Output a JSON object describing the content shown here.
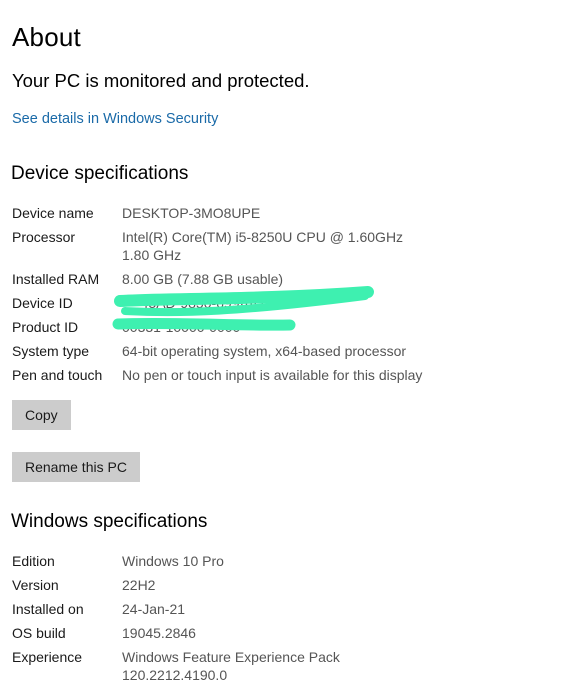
{
  "page": {
    "title": "About",
    "protection_status": "Your PC is monitored and protected.",
    "security_link": "See details in Windows Security"
  },
  "device_specs": {
    "heading": "Device specifications",
    "rows": [
      {
        "label": "Device name",
        "value": "DESKTOP-3MO8UPE"
      },
      {
        "label": "Processor",
        "value": "Intel(R) Core(TM) i5-8250U CPU @ 1.60GHz   1.80 GHz"
      },
      {
        "label": "Installed RAM",
        "value": "8.00 GB (7.88 GB usable)"
      },
      {
        "label": "Device ID",
        "value": "···-43AD-9850-699···D7E3C"
      },
      {
        "label": "Product ID",
        "value": "00331-10000-0000"
      },
      {
        "label": "System type",
        "value": "64-bit operating system, x64-based processor"
      },
      {
        "label": "Pen and touch",
        "value": "No pen or touch input is available for this display"
      }
    ],
    "copy_button": "Copy",
    "rename_button": "Rename this PC"
  },
  "windows_specs": {
    "heading": "Windows specifications",
    "rows": [
      {
        "label": "Edition",
        "value": "Windows 10 Pro"
      },
      {
        "label": "Version",
        "value": "22H2"
      },
      {
        "label": "Installed on",
        "value": "24-Jan-21"
      },
      {
        "label": "OS build",
        "value": "19045.2846"
      },
      {
        "label": "Experience",
        "value": "Windows Feature Experience Pack 120.2212.4190.0"
      }
    ]
  },
  "colors": {
    "link": "#1a6aa8",
    "button_bg": "#cccccc",
    "redaction_marker": "#3ef0b0"
  }
}
